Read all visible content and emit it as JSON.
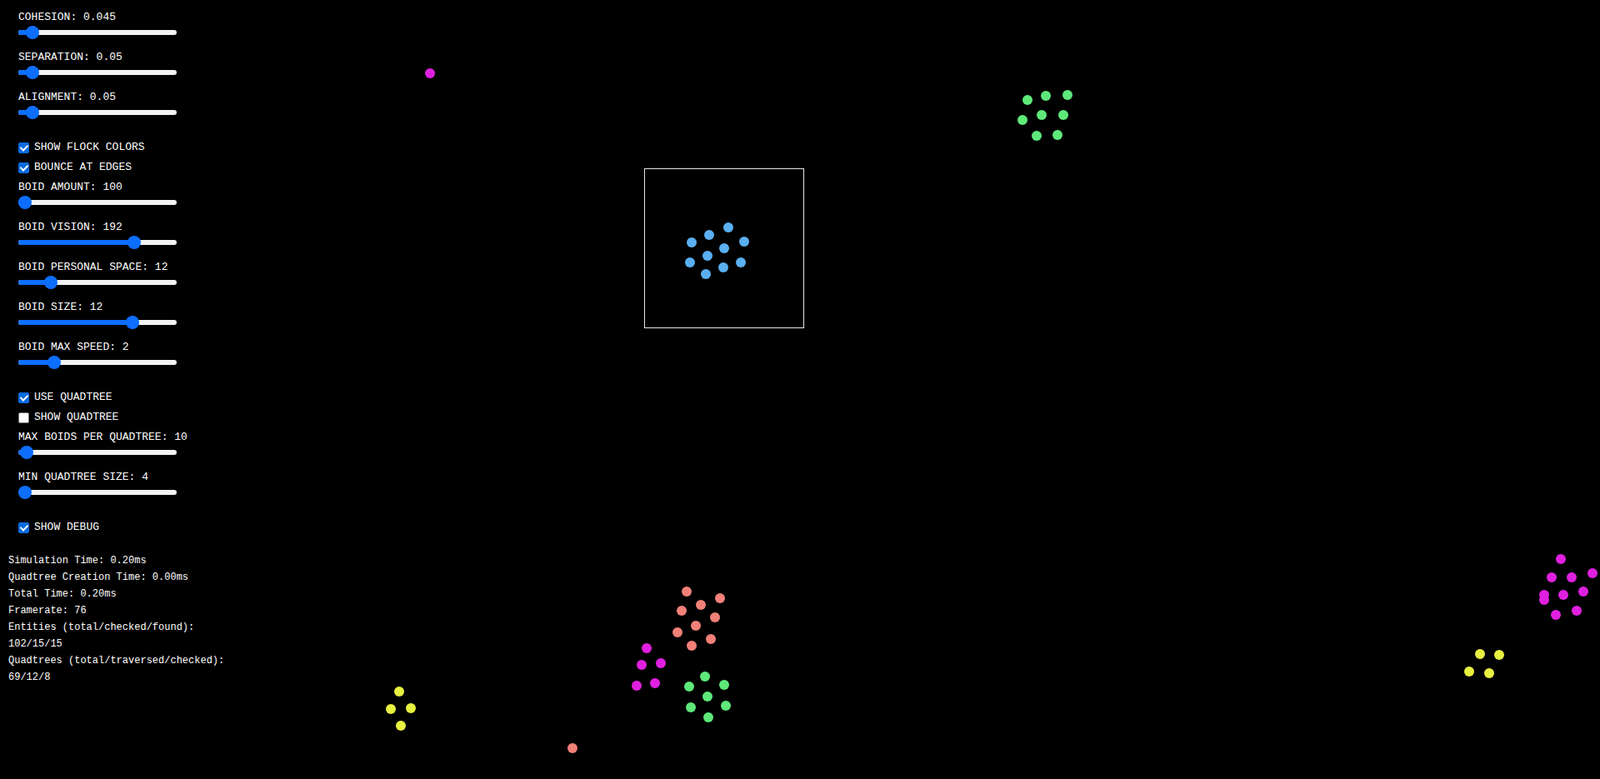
{
  "controls": [
    {
      "kind": "slider",
      "label": "COHESION: 0.045",
      "level": 0.05
    },
    {
      "kind": "slider",
      "label": "SEPARATION: 0.05",
      "level": 0.05
    },
    {
      "kind": "slider",
      "label": "ALIGNMENT: 0.05",
      "level": 0.05
    },
    {
      "kind": "checkbox",
      "label": "SHOW FLOCK COLORS",
      "checked": true
    },
    {
      "kind": "checkbox",
      "label": "BOUNCE AT EDGES",
      "checked": true
    },
    {
      "kind": "slider",
      "label": "BOID AMOUNT: 100",
      "level": 0.0
    },
    {
      "kind": "slider",
      "label": "BOID VISION: 192",
      "level": 0.75
    },
    {
      "kind": "slider",
      "label": "BOID PERSONAL SPACE: 12",
      "level": 0.18
    },
    {
      "kind": "slider",
      "label": "BOID SIZE: 12",
      "level": 0.74
    },
    {
      "kind": "slider",
      "label": "BOID MAX SPEED: 2",
      "level": 0.2
    },
    {
      "kind": "checkbox",
      "label": "USE QUADTREE",
      "checked": true
    },
    {
      "kind": "checkbox",
      "label": "SHOW QUADTREE",
      "checked": false
    },
    {
      "kind": "slider",
      "label": "MAX BOIDS PER QUADTREE: 10",
      "level": 0.01
    },
    {
      "kind": "slider",
      "label": "MIN QUADTREE SIZE: 4",
      "level": 0.0
    },
    {
      "kind": "checkbox",
      "label": "SHOW DEBUG",
      "checked": true
    }
  ],
  "debug": {
    "lines": [
      "Simulation Time: 0.20ms",
      "Quadtree Creation Time: 0.00ms",
      "Total Time: 0.20ms",
      "Framerate: 76",
      "Entities (total/checked/found):",
      "102/15/15",
      "Quadtrees (total/traversed/checked):",
      "69/12/8"
    ]
  },
  "flocks": [
    {
      "color": "#5aaff0"
    },
    {
      "color": "#5ee87a"
    },
    {
      "color": "#f08078"
    },
    {
      "color": "#e020e0"
    },
    {
      "color": "#e8f040"
    }
  ]
}
